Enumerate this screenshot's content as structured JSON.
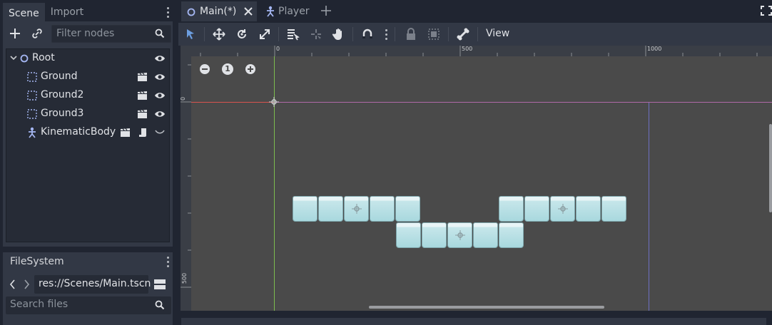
{
  "left_dock": {
    "tabs": [
      {
        "label": "Scene",
        "active": true
      },
      {
        "label": "Import",
        "active": false
      }
    ],
    "filter_placeholder": "Filter nodes",
    "tree": [
      {
        "label": "Root",
        "icon": "node2d-root-icon",
        "expanded": true
      },
      {
        "label": "Ground",
        "icon": "tilemap-icon"
      },
      {
        "label": "Ground2",
        "icon": "tilemap-icon"
      },
      {
        "label": "Ground3",
        "icon": "tilemap-icon"
      },
      {
        "label": "KinematicBody",
        "icon": "kinematic-body-icon"
      }
    ],
    "filesystem": {
      "tab_label": "FileSystem",
      "path": "res://Scenes/Main.tscn",
      "search_placeholder": "Search files"
    }
  },
  "main": {
    "tabs": [
      {
        "label": "Main(*)",
        "active": true
      },
      {
        "label": "Player",
        "active": false
      }
    ],
    "toolbar": {
      "view_label": "View"
    },
    "rulers": {
      "top": [
        "0",
        "500",
        "1000"
      ],
      "left": [
        "0",
        "500"
      ]
    },
    "zoom_reset_label": "1"
  },
  "colors": {
    "panel_bg": "#323845",
    "dark_bg": "#202531",
    "viewport_bg": "#4a4a4a",
    "accent_blue": "#6c9ee0",
    "x_axis": "#d9534f",
    "y_axis": "#7dbd4f"
  }
}
